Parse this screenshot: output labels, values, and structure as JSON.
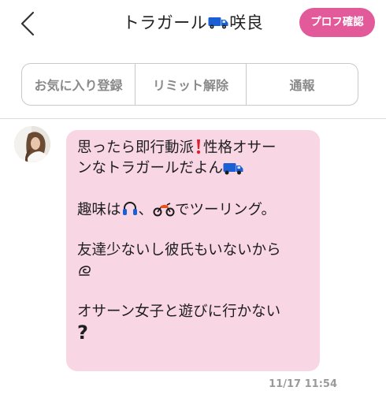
{
  "header": {
    "title_prefix": "トラガール",
    "title_suffix": "咲良",
    "title_icon": "truck-icon",
    "profile_button": "プロフ確認",
    "back_icon": "chevron-left-icon"
  },
  "actions": {
    "favorite": "お気に入り登録",
    "limit_release": "リミット解除",
    "report": "通報"
  },
  "message": {
    "lines": [
      {
        "parts": [
          "思ったら即行動派",
          "",
          "性格オサー"
        ]
      },
      {
        "parts": [
          "ーンなトラガールだよん"
        ]
      },
      {
        "parts": [
          ""
        ]
      },
      {
        "parts": [
          "趣味は",
          "、",
          "でツーリング。"
        ]
      },
      {
        "parts": [
          ""
        ]
      },
      {
        "parts": [
          "友達少ないし彼氏もいないから"
        ]
      },
      {
        "parts": [
          ""
        ]
      },
      {
        "parts": [
          ""
        ]
      },
      {
        "parts": [
          "オサーン女子と遊びに行かない"
        ]
      },
      {
        "parts": [
          "?"
        ]
      }
    ],
    "line1a": "思ったら即行動派",
    "line1b": "性格オサー",
    "line2": "ンなトラガールだよん",
    "line4a": "趣味は",
    "line4b": "、",
    "line4c": "でツーリング。",
    "line6": "友達少ないし彼氏もいないから",
    "line9": "オサーン女子と遊びに行かない",
    "line10": "?",
    "timestamp": "11/17 11:54"
  },
  "colors": {
    "accent_pink": "#e25a9a",
    "bubble": "#f9d6e4",
    "truck_blue": "#1a5fd4",
    "exclamation_red": "#e01e2d"
  },
  "icons": [
    "exclamation-icon",
    "truck-icon",
    "headphones-icon",
    "motorcycle-icon",
    "swirl-icon"
  ]
}
